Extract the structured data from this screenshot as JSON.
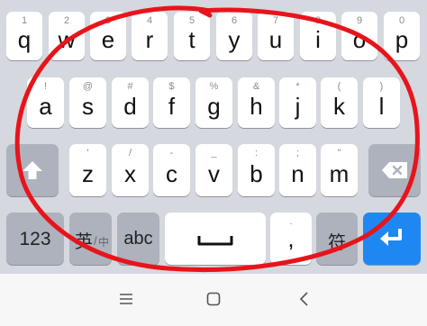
{
  "keyboard": {
    "row1": [
      {
        "hint": "1",
        "letter": "q"
      },
      {
        "hint": "2",
        "letter": "w"
      },
      {
        "hint": "3",
        "letter": "e"
      },
      {
        "hint": "4",
        "letter": "r"
      },
      {
        "hint": "5",
        "letter": "t"
      },
      {
        "hint": "6",
        "letter": "y"
      },
      {
        "hint": "7",
        "letter": "u"
      },
      {
        "hint": "8",
        "letter": "i"
      },
      {
        "hint": "9",
        "letter": "o"
      },
      {
        "hint": "0",
        "letter": "p"
      }
    ],
    "row2": [
      {
        "hint": "!",
        "letter": "a"
      },
      {
        "hint": "@",
        "letter": "s"
      },
      {
        "hint": "#",
        "letter": "d"
      },
      {
        "hint": "$",
        "letter": "f"
      },
      {
        "hint": "%",
        "letter": "g"
      },
      {
        "hint": "&",
        "letter": "h"
      },
      {
        "hint": "*",
        "letter": "j"
      },
      {
        "hint": "(",
        "letter": "k"
      },
      {
        "hint": ")",
        "letter": "l"
      }
    ],
    "row3": [
      {
        "hint": "'",
        "letter": "z"
      },
      {
        "hint": "/",
        "letter": "x"
      },
      {
        "hint": "-",
        "letter": "c"
      },
      {
        "hint": "_",
        "letter": "v"
      },
      {
        "hint": ":",
        "letter": "b"
      },
      {
        "hint": ";",
        "letter": "n"
      },
      {
        "hint": "\"",
        "letter": "m"
      }
    ],
    "bottom": {
      "numbers_label": "123",
      "lang_primary": "英",
      "lang_secondary": "中",
      "abc_label": "abc",
      "comma_hint": ".",
      "comma_label": ",",
      "symbol_label": "符"
    }
  },
  "icons": {
    "shift": "shift-icon",
    "backspace": "backspace-icon",
    "space": "space-icon",
    "enter": "enter-icon",
    "nav_menu": "menu-icon",
    "nav_home": "home-icon",
    "nav_back": "back-icon"
  },
  "colors": {
    "keyboard_bg": "#d5d8de",
    "key_bg": "#ffffff",
    "function_key_bg": "#adb2bd",
    "enter_key_bg": "#1f87f2",
    "annotation_circle": "#e8141b"
  }
}
